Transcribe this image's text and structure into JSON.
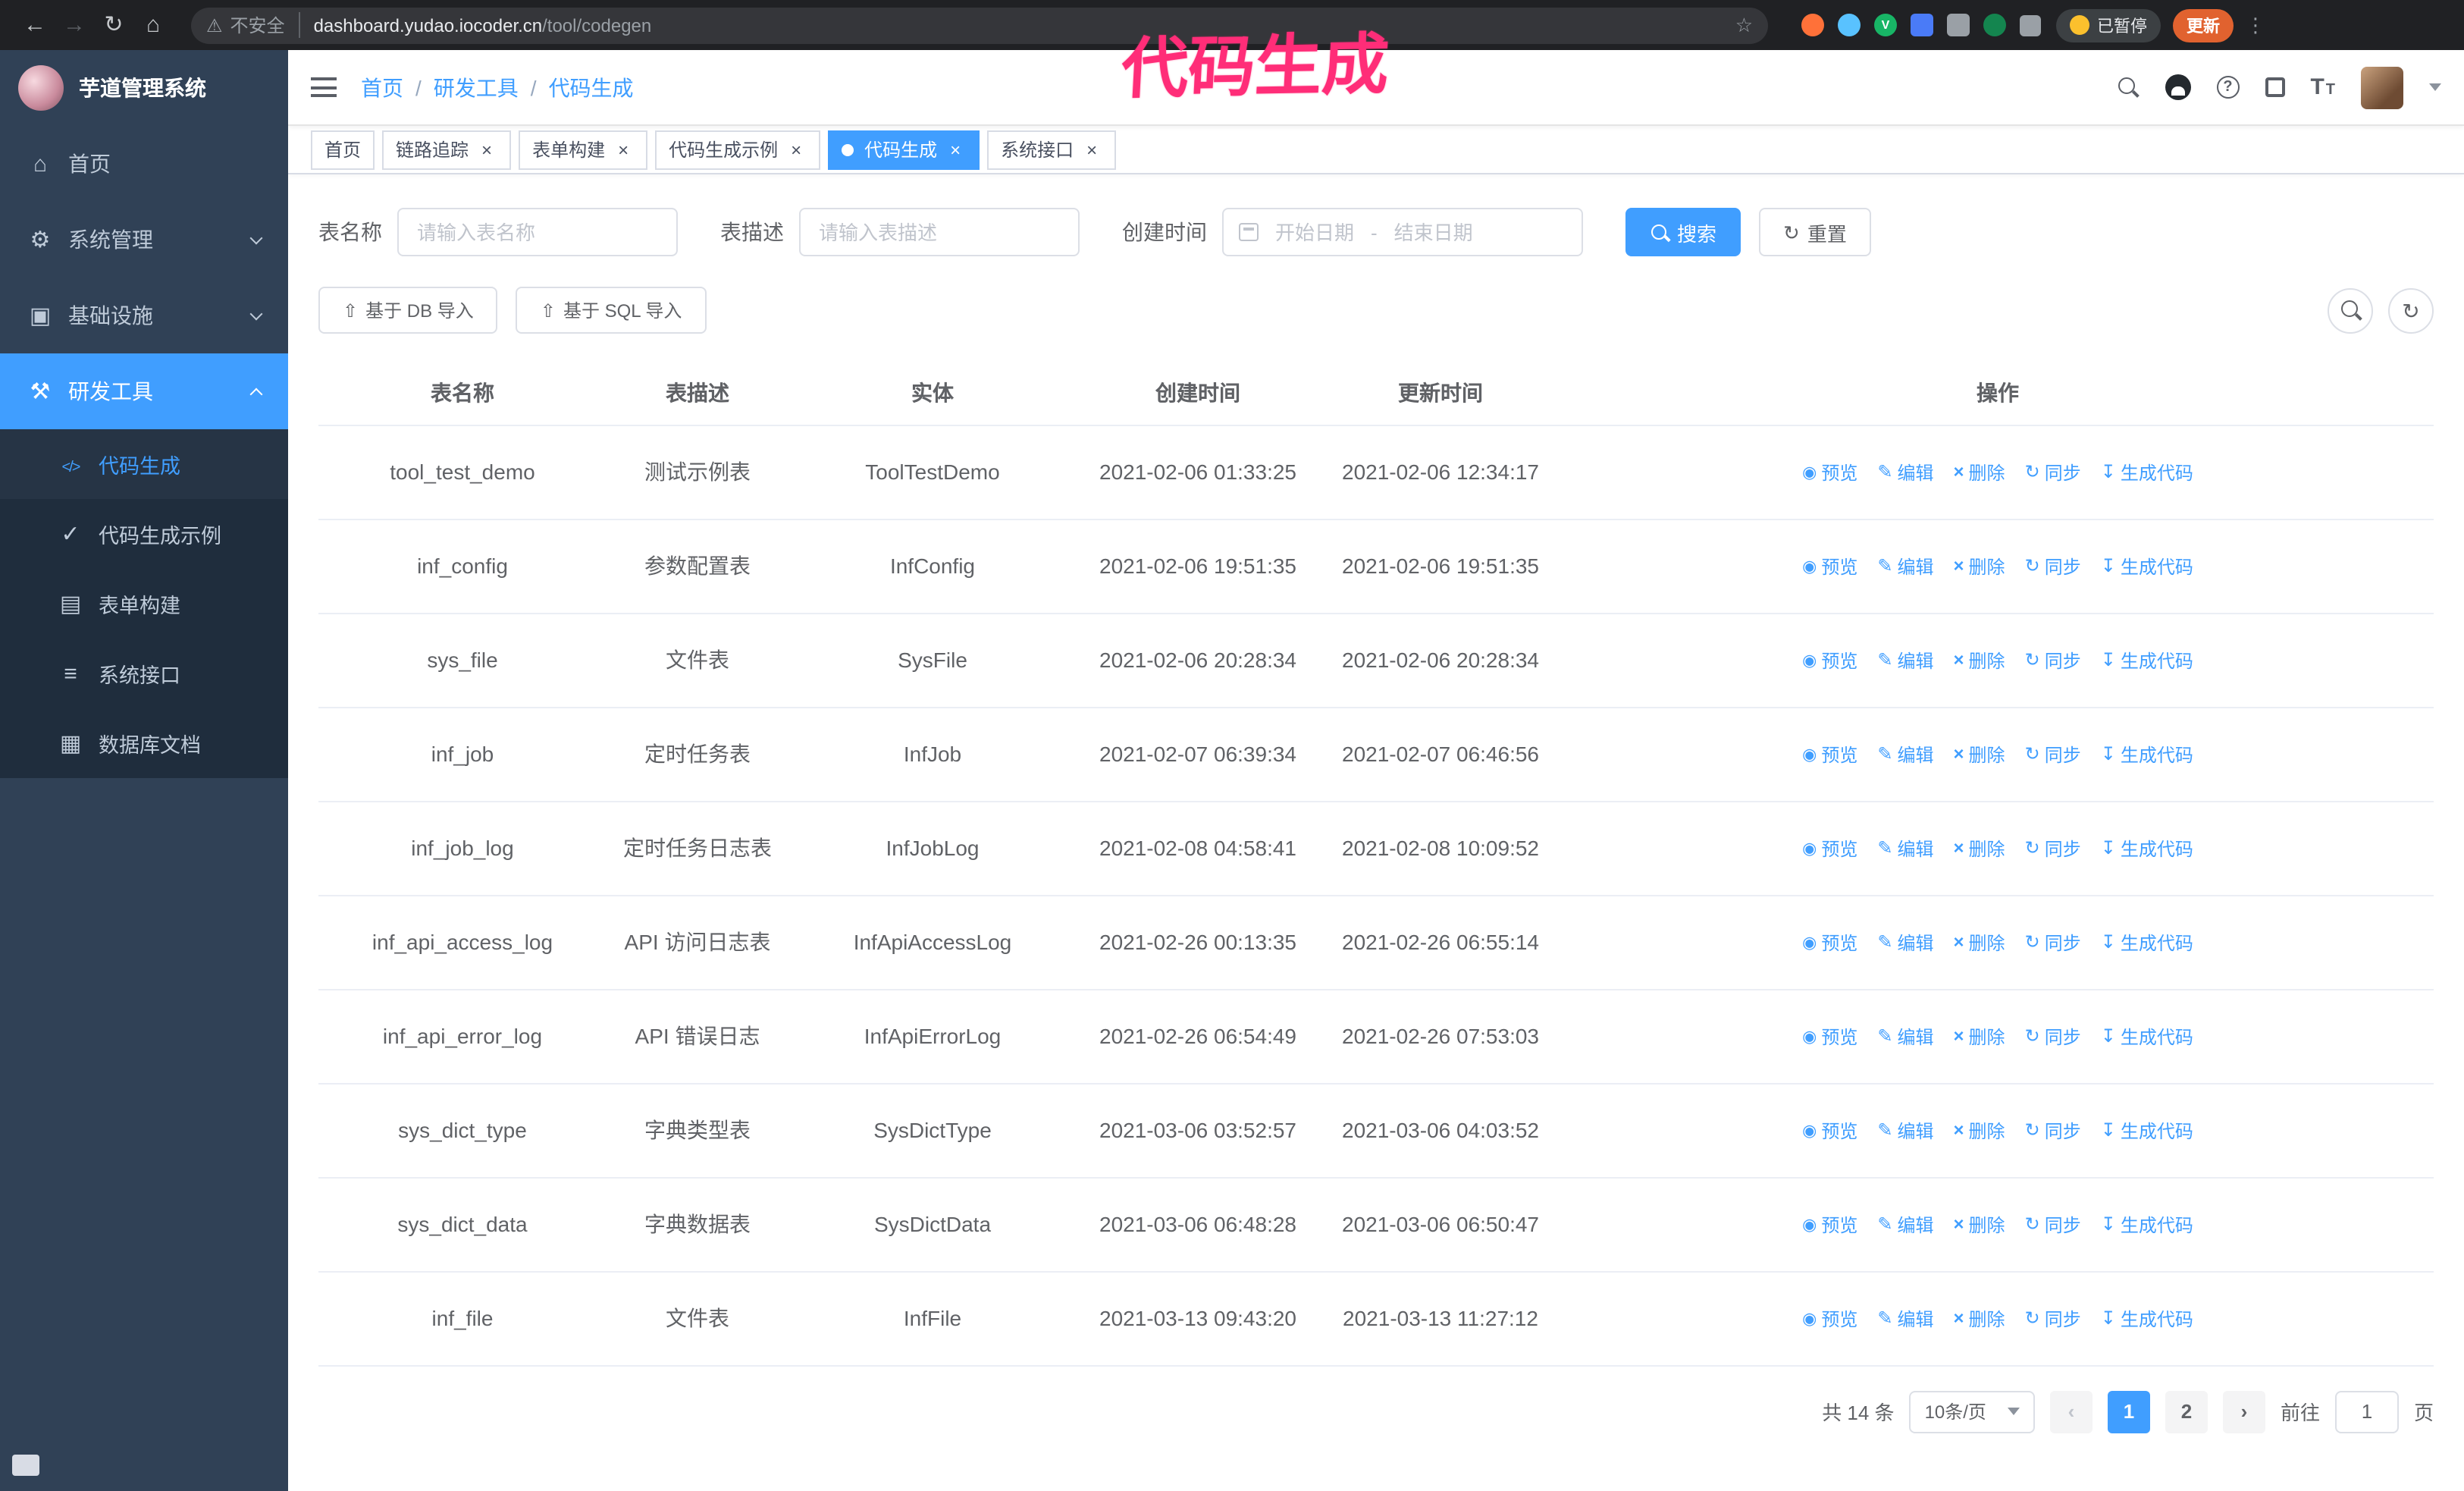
{
  "browser": {
    "security_label": "不安全",
    "url_host": "dashboard.yudao.iocoder.cn",
    "url_path": "/tool/codegen",
    "paused_badge": "已暂停",
    "update_button": "更新"
  },
  "annotation": {
    "text": "代码生成"
  },
  "colors": {
    "accent": "#409eff",
    "sidebar_bg": "#304156",
    "submenu_bg": "#1f2d3d",
    "annotation_pink": "#ff2d78",
    "update_button_bg": "#e1622f"
  },
  "sidebar": {
    "title": "芋道管理系统",
    "items": [
      {
        "label": "首页",
        "icon": "home-icon"
      },
      {
        "label": "系统管理",
        "icon": "gear-icon",
        "chevron": "down"
      },
      {
        "label": "基础设施",
        "icon": "monitor-icon",
        "chevron": "down"
      },
      {
        "label": "研发工具",
        "icon": "tools-icon",
        "chevron": "up",
        "active": true
      }
    ],
    "subitems": [
      {
        "label": "代码生成",
        "icon": "code-icon",
        "active": true
      },
      {
        "label": "代码生成示例",
        "icon": "check-icon"
      },
      {
        "label": "表单构建",
        "icon": "form-icon"
      },
      {
        "label": "系统接口",
        "icon": "api-icon"
      },
      {
        "label": "数据库文档",
        "icon": "grid-icon"
      }
    ]
  },
  "navbar": {
    "breadcrumb": [
      "首页",
      "研发工具",
      "代码生成"
    ]
  },
  "tabs": [
    {
      "label": "首页",
      "closable": false
    },
    {
      "label": "链路追踪",
      "closable": true
    },
    {
      "label": "表单构建",
      "closable": true
    },
    {
      "label": "代码生成示例",
      "closable": true
    },
    {
      "label": "代码生成",
      "closable": true,
      "active": true
    },
    {
      "label": "系统接口",
      "closable": true
    }
  ],
  "filters": {
    "table_name_label": "表名称",
    "table_name_placeholder": "请输入表名称",
    "table_desc_label": "表描述",
    "table_desc_placeholder": "请输入表描述",
    "create_time_label": "创建时间",
    "start_placeholder": "开始日期",
    "range_separator": "-",
    "end_placeholder": "结束日期",
    "search_button": "搜索",
    "reset_button": "重置"
  },
  "toolbar": {
    "import_db": "基于 DB 导入",
    "import_sql": "基于 SQL 导入"
  },
  "table": {
    "columns": [
      "表名称",
      "表描述",
      "实体",
      "创建时间",
      "更新时间",
      "操作"
    ],
    "actions": [
      {
        "label": "预览",
        "icon": "eye-icon"
      },
      {
        "label": "编辑",
        "icon": "pencil-icon"
      },
      {
        "label": "删除",
        "icon": "trash-icon"
      },
      {
        "label": "同步",
        "icon": "sync-icon"
      },
      {
        "label": "生成代码",
        "icon": "download-icon"
      }
    ],
    "rows": [
      {
        "name": "tool_test_demo",
        "desc": "测试示例表",
        "entity": "ToolTestDemo",
        "created": "2021-02-06 01:33:25",
        "updated": "2021-02-06 12:34:17"
      },
      {
        "name": "inf_config",
        "desc": "参数配置表",
        "entity": "InfConfig",
        "created": "2021-02-06 19:51:35",
        "updated": "2021-02-06 19:51:35"
      },
      {
        "name": "sys_file",
        "desc": "文件表",
        "entity": "SysFile",
        "created": "2021-02-06 20:28:34",
        "updated": "2021-02-06 20:28:34"
      },
      {
        "name": "inf_job",
        "desc": "定时任务表",
        "entity": "InfJob",
        "created": "2021-02-07 06:39:34",
        "updated": "2021-02-07 06:46:56"
      },
      {
        "name": "inf_job_log",
        "desc": "定时任务日志表",
        "entity": "InfJobLog",
        "created": "2021-02-08 04:58:41",
        "updated": "2021-02-08 10:09:52"
      },
      {
        "name": "inf_api_access_log",
        "desc": "API 访问日志表",
        "entity": "InfApiAccessLog",
        "created": "2021-02-26 00:13:35",
        "updated": "2021-02-26 06:55:14"
      },
      {
        "name": "inf_api_error_log",
        "desc": "API 错误日志",
        "entity": "InfApiErrorLog",
        "created": "2021-02-26 06:54:49",
        "updated": "2021-02-26 07:53:03"
      },
      {
        "name": "sys_dict_type",
        "desc": "字典类型表",
        "entity": "SysDictType",
        "created": "2021-03-06 03:52:57",
        "updated": "2021-03-06 04:03:52"
      },
      {
        "name": "sys_dict_data",
        "desc": "字典数据表",
        "entity": "SysDictData",
        "created": "2021-03-06 06:48:28",
        "updated": "2021-03-06 06:50:47"
      },
      {
        "name": "inf_file",
        "desc": "文件表",
        "entity": "InfFile",
        "created": "2021-03-13 09:43:20",
        "updated": "2021-03-13 11:27:12"
      }
    ]
  },
  "pagination": {
    "total": "共 14 条",
    "page_size": "10条/页",
    "pages": [
      "1",
      "2"
    ],
    "active_page": "1",
    "goto_label": "前往",
    "goto_value": "1",
    "goto_suffix": "页"
  }
}
